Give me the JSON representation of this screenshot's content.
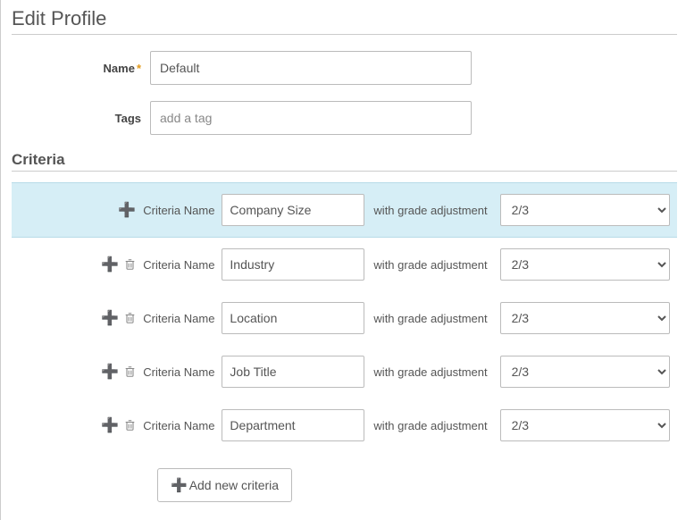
{
  "header": {
    "title": "Edit Profile"
  },
  "form": {
    "name_label": "Name",
    "name_value": "Default",
    "tags_label": "Tags",
    "tags_placeholder": "add a tag",
    "tags_value": ""
  },
  "criteria_section": {
    "title": "Criteria",
    "row_label": "Criteria Name",
    "adjust_label": "with grade adjustment",
    "add_button_label": "Add new criteria",
    "rows": [
      {
        "name": "Company Size",
        "grade": "2/3",
        "selected": true,
        "show_trash": false
      },
      {
        "name": "Industry",
        "grade": "2/3",
        "selected": false,
        "show_trash": true
      },
      {
        "name": "Location",
        "grade": "2/3",
        "selected": false,
        "show_trash": true
      },
      {
        "name": "Job Title",
        "grade": "2/3",
        "selected": false,
        "show_trash": true
      },
      {
        "name": "Department",
        "grade": "2/3",
        "selected": false,
        "show_trash": true
      }
    ]
  }
}
